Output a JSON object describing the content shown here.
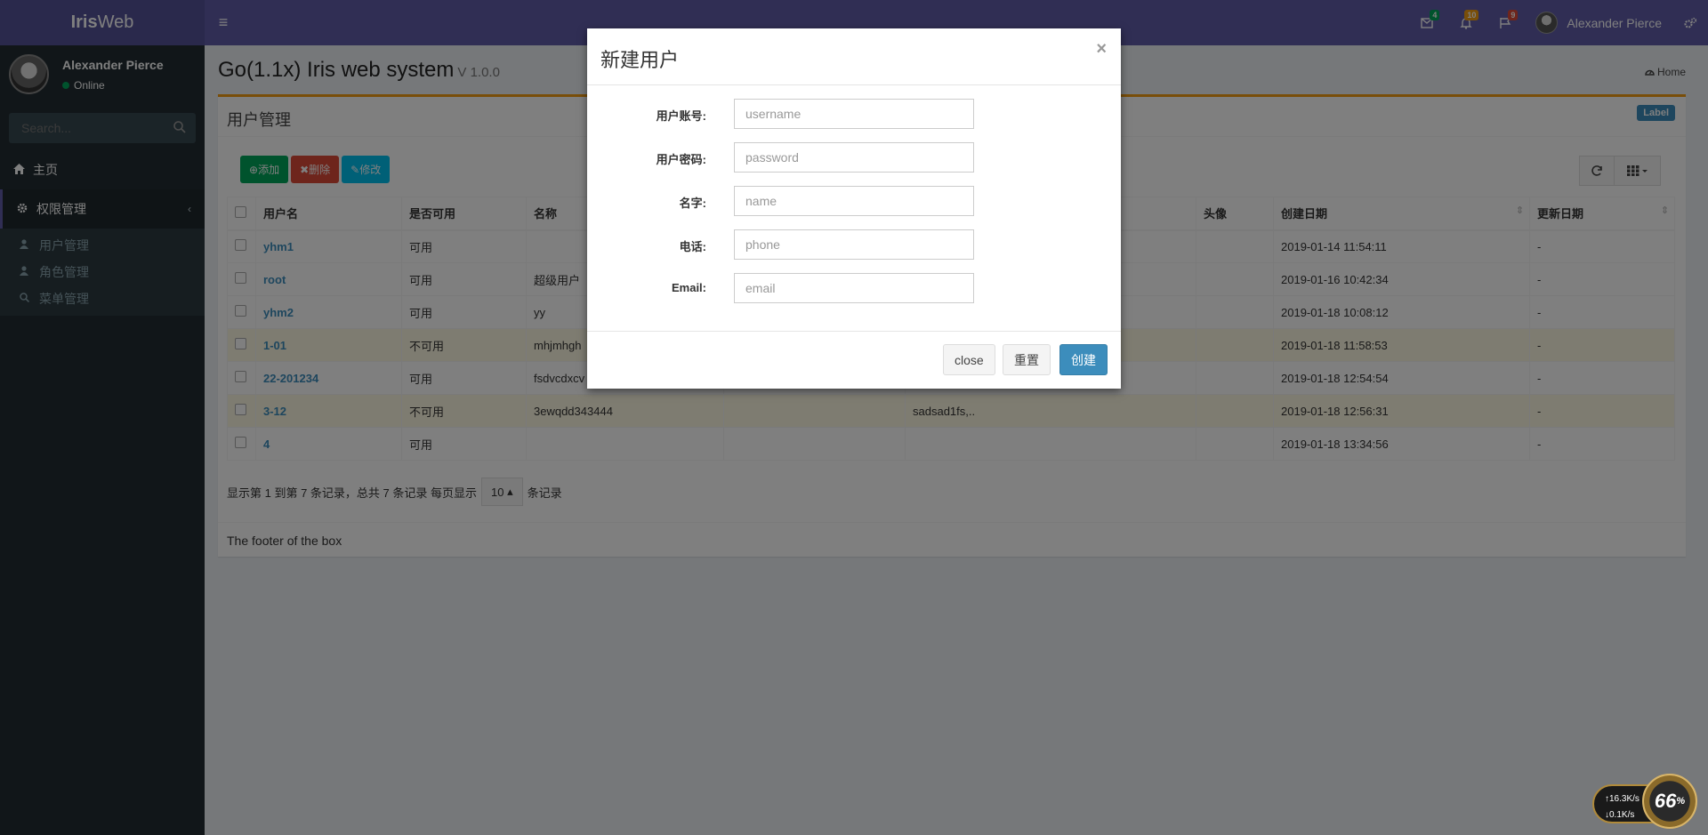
{
  "header": {
    "logo_bold": "Iris",
    "logo_rest": "Web",
    "toggle_glyph": "≡",
    "badges": [
      {
        "icon": "envelope-icon",
        "count": "4",
        "color": "#00a65a"
      },
      {
        "icon": "bell-icon",
        "count": "10",
        "color": "#f39c12"
      },
      {
        "icon": "flag-icon",
        "count": "9",
        "color": "#dd4b39"
      }
    ],
    "user_name": "Alexander Pierce"
  },
  "sidebar": {
    "user_name": "Alexander Pierce",
    "status": "Online",
    "search_placeholder": "Search...",
    "menu": [
      {
        "label": "主页",
        "icon": "home-icon"
      },
      {
        "label": "权限管理",
        "icon": "gear-icon"
      }
    ],
    "submenu": [
      {
        "label": "用户管理",
        "icon": "user-icon"
      },
      {
        "label": "角色管理",
        "icon": "user-icon"
      },
      {
        "label": "菜单管理",
        "icon": "search-icon"
      }
    ]
  },
  "content": {
    "title": "Go(1.1x) Iris web system",
    "version": "V 1.0.0",
    "breadcrumb": "Home",
    "box_title": "用户管理",
    "label": "Label",
    "toolbar": {
      "add": "添加",
      "delete": "删除",
      "edit": "修改"
    },
    "table": {
      "headers": [
        "用户名",
        "是否可用",
        "名称",
        "",
        "",
        "头像",
        "创建日期",
        "更新日期"
      ],
      "rows": [
        {
          "username": "yhm1",
          "enabled": "可用",
          "name": "",
          "c4": "",
          "c5": "",
          "avatar": "",
          "created": "2019-01-14 11:54:11",
          "updated": "-",
          "hl": false
        },
        {
          "username": "root",
          "enabled": "可用",
          "name": "超级用户",
          "c4": "",
          "c5": "",
          "avatar": "",
          "created": "2019-01-16 10:42:34",
          "updated": "-",
          "hl": false
        },
        {
          "username": "yhm2",
          "enabled": "可用",
          "name": "yy",
          "c4": "",
          "c5": "",
          "avatar": "",
          "created": "2019-01-18 10:08:12",
          "updated": "-",
          "hl": false
        },
        {
          "username": "1-01",
          "enabled": "不可用",
          "name": "mhjmhgh",
          "c4": "",
          "c5": "",
          "avatar": "",
          "created": "2019-01-18 11:58:53",
          "updated": "-",
          "hl": true
        },
        {
          "username": "22-201234",
          "enabled": "可用",
          "name": "fsdvcdxcv",
          "c4": "",
          "c5": "",
          "avatar": "",
          "created": "2019-01-18 12:54:54",
          "updated": "-",
          "hl": false
        },
        {
          "username": "3-12",
          "enabled": "不可用",
          "name": "3ewqdd343444",
          "c4": "",
          "c5": "sadsad1fs,..",
          "avatar": "",
          "created": "2019-01-18 12:56:31",
          "updated": "-",
          "hl": true
        },
        {
          "username": "4",
          "enabled": "可用",
          "name": "",
          "c4": "",
          "c5": "",
          "avatar": "",
          "created": "2019-01-18 13:34:56",
          "updated": "-",
          "hl": false
        }
      ]
    },
    "pager": {
      "prefix": "显示第 1 到第 7 条记录，总共 7 条记录 每页显示",
      "page_size": "10",
      "suffix": "条记录"
    },
    "footer": "The footer of the box"
  },
  "modal": {
    "title": "新建用户",
    "close_glyph": "×",
    "fields": [
      {
        "label": "用户账号:",
        "placeholder": "username"
      },
      {
        "label": "用户密码:",
        "placeholder": "password"
      },
      {
        "label": "名字:",
        "placeholder": "name"
      },
      {
        "label": "电话:",
        "placeholder": "phone"
      },
      {
        "label": "Email:",
        "placeholder": "email"
      }
    ],
    "buttons": {
      "close": "close",
      "reset": "重置",
      "create": "创建"
    }
  },
  "net_widget": {
    "up": "16.3K/s",
    "down": "0.1K/s",
    "percent": "66",
    "unit": "%"
  }
}
